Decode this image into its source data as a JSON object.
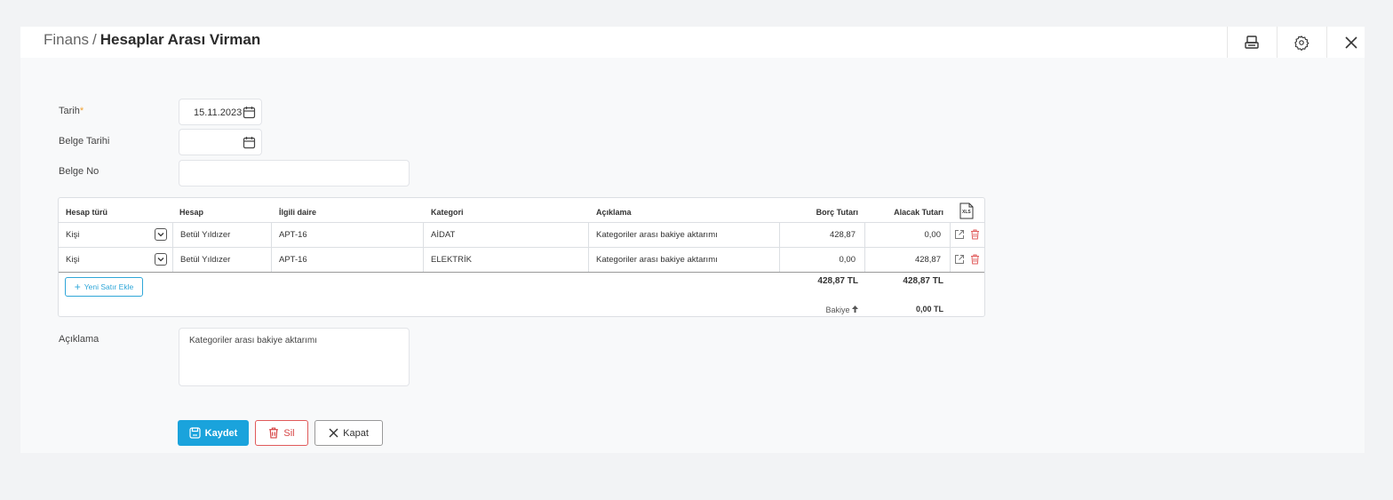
{
  "header": {
    "breadcrumb_root": "Finans",
    "breadcrumb_sep": "/",
    "breadcrumb_current": "Hesaplar Arası Virman"
  },
  "form": {
    "tarih_label": "Tarih",
    "required_mark": "*",
    "tarih_value": "15.11.2023",
    "belge_tarihi_label": "Belge Tarihi",
    "belge_tarihi_value": "",
    "belge_no_label": "Belge No",
    "belge_no_value": ""
  },
  "grid": {
    "columns": [
      "Hesap türü",
      "Hesap",
      "İlgili daire",
      "Kategori",
      "Açıklama",
      "Borç Tutarı",
      "Alacak Tutarı"
    ],
    "xls_label": "XLS",
    "rows": [
      {
        "hesap_turu": "Kişi",
        "hesap": "Betül Yıldızer",
        "daire": "APT-16",
        "kategori": "AİDAT",
        "aciklama": "Kategoriler arası bakiye aktarımı",
        "borc": "428,87",
        "alacak": "0,00"
      },
      {
        "hesap_turu": "Kişi",
        "hesap": "Betül Yıldızer",
        "daire": "APT-16",
        "kategori": "ELEKTRİK",
        "aciklama": "Kategoriler arası bakiye aktarımı",
        "borc": "0,00",
        "alacak": "428,87"
      }
    ],
    "add_row_label": "Yeni Satır Ekle",
    "total_borc": "428,87 TL",
    "total_alacak": "428,87 TL",
    "bakiye_label": "Bakiye",
    "bakiye_value": "0,00 TL"
  },
  "aciklama": {
    "label": "Açıklama",
    "value": "Kategoriler arası bakiye aktarımı"
  },
  "buttons": {
    "save": "Kaydet",
    "delete": "Sil",
    "close": "Kapat"
  },
  "colors": {
    "accent": "#1aa3dc",
    "danger": "#d64545",
    "required": "#f0a030"
  },
  "icons": {
    "print": "print-icon",
    "settings": "gear-icon",
    "close": "close-icon",
    "calendar": "calendar-icon",
    "edit": "external-link-icon",
    "delete": "trash-icon"
  }
}
